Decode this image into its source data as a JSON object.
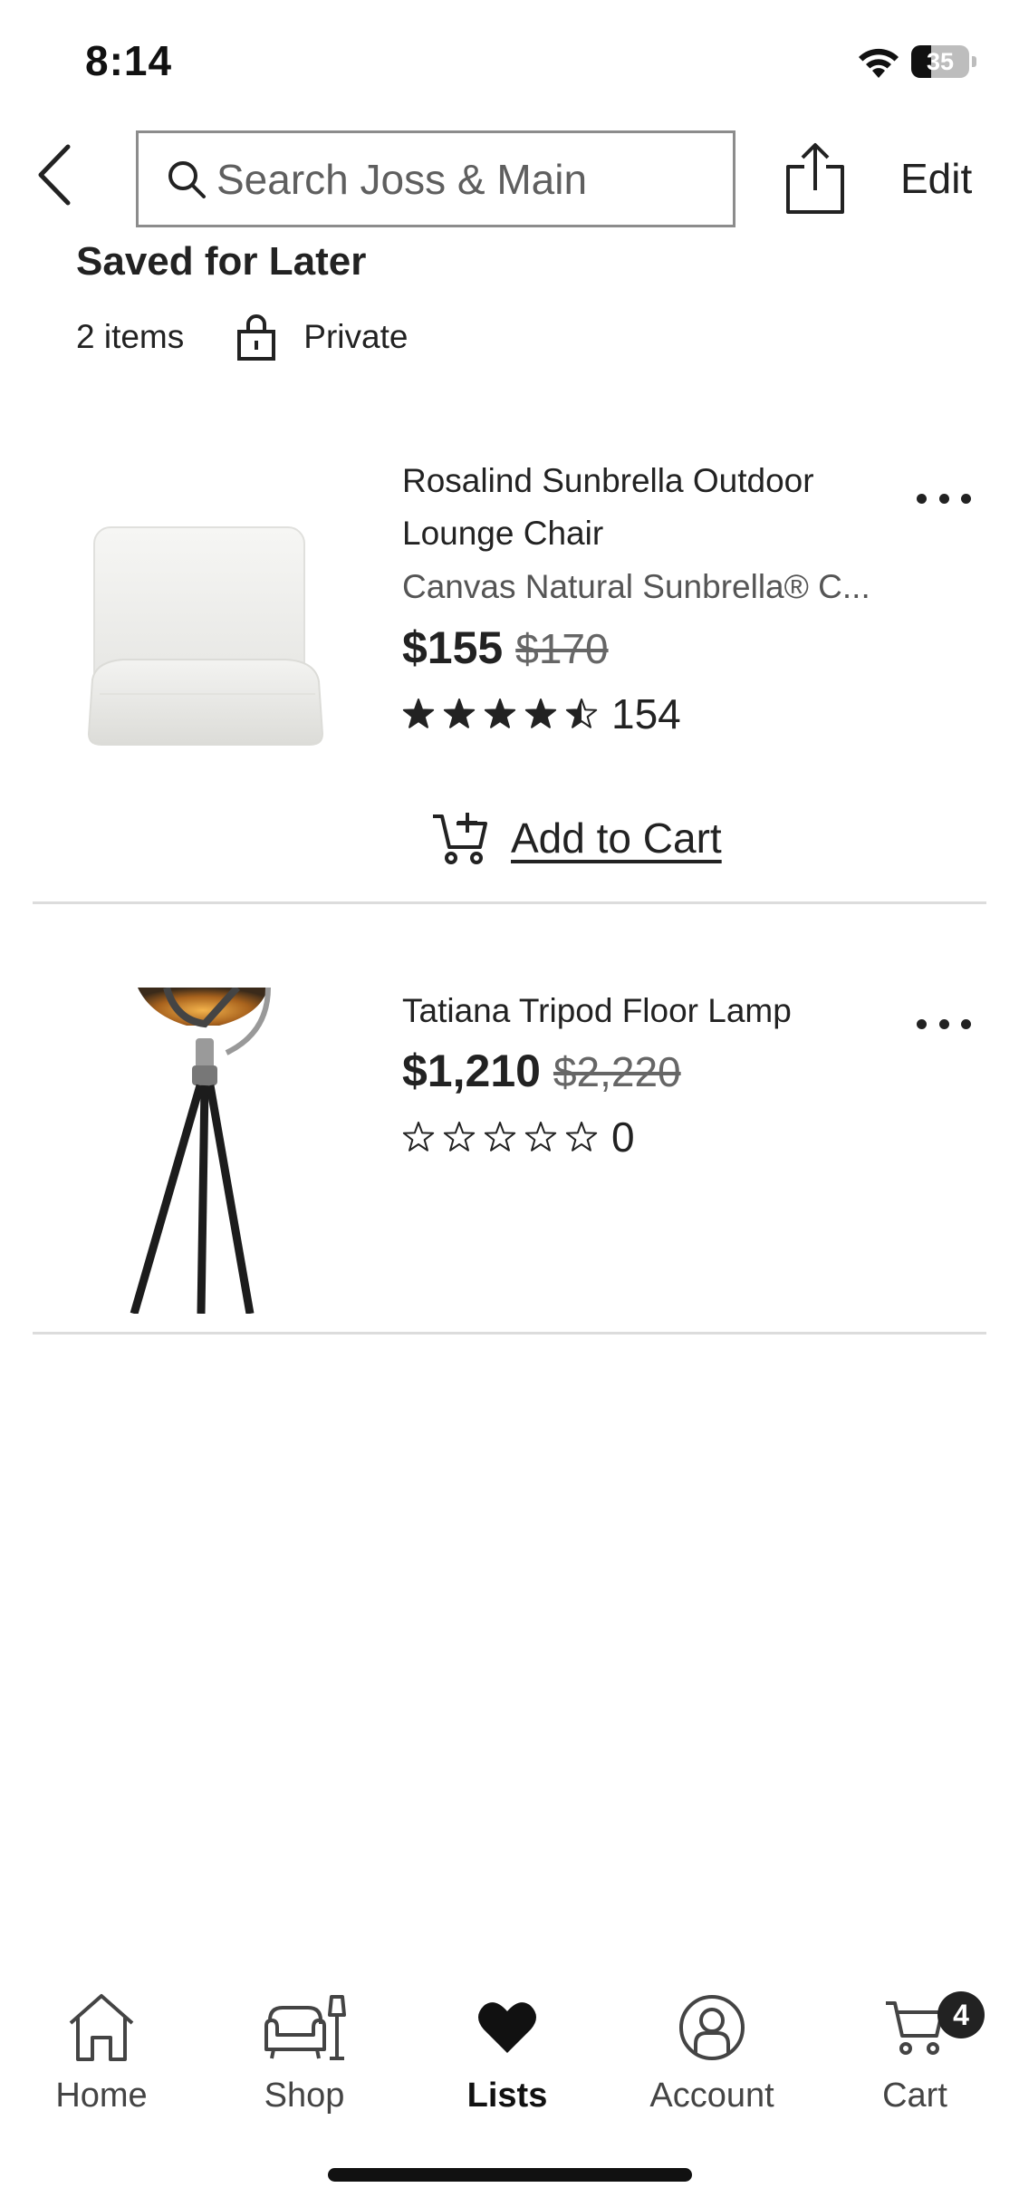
{
  "status_bar": {
    "time": "8:14",
    "battery_level": "35"
  },
  "nav": {
    "search_placeholder": "Search Joss & Main",
    "edit_label": "Edit"
  },
  "list": {
    "title": "Saved for Later",
    "item_count": "2 items",
    "privacy": "Private"
  },
  "items": [
    {
      "name": "Rosalind Sunbrella Outdoor Lounge Chair",
      "variant": "Canvas Natural Sunbrella® C...",
      "sale_price": "$155",
      "original_price": "$170",
      "rating": 4.5,
      "review_count": "154",
      "add_to_cart_label": "Add to Cart"
    },
    {
      "name": "Tatiana Tripod Floor Lamp",
      "sale_price": "$1,210",
      "original_price": "$2,220",
      "rating": 0,
      "review_count": "0"
    }
  ],
  "tabs": [
    {
      "label": "Home",
      "icon": "home-icon"
    },
    {
      "label": "Shop",
      "icon": "sofa-lamp-icon"
    },
    {
      "label": "Lists",
      "icon": "heart-icon",
      "active": true
    },
    {
      "label": "Account",
      "icon": "account-icon"
    },
    {
      "label": "Cart",
      "icon": "cart-icon",
      "badge": "4"
    }
  ]
}
